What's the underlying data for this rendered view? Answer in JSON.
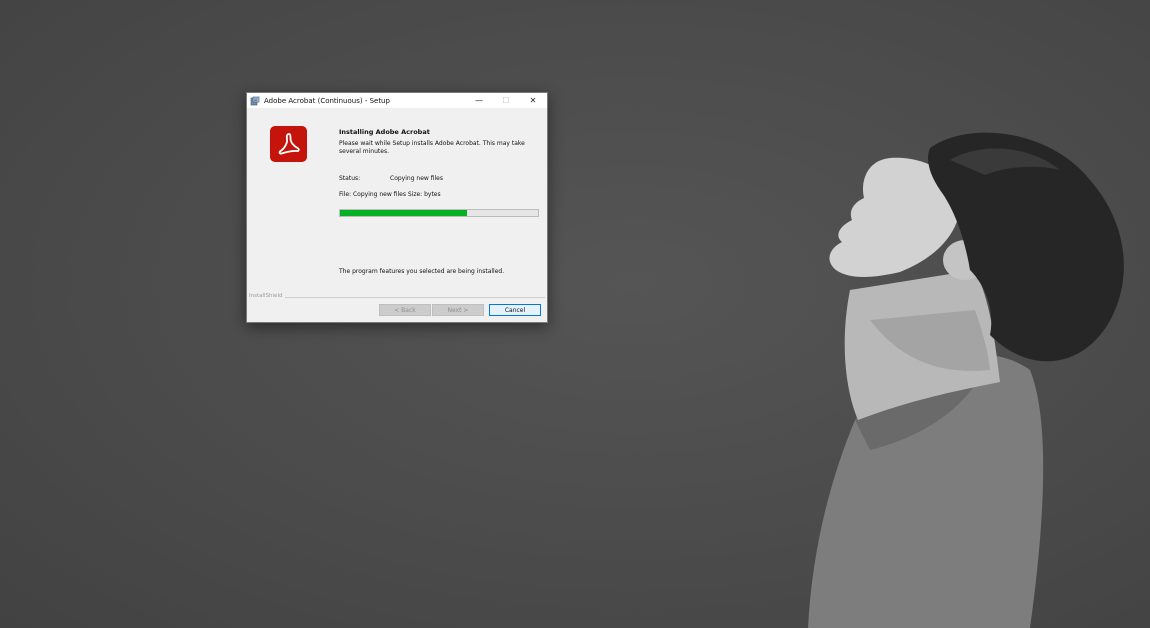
{
  "window": {
    "title": "Adobe Acrobat (Continuous) - Setup",
    "minimize_glyph": "—",
    "maximize_glyph": "☐",
    "close_glyph": "✕"
  },
  "installer": {
    "heading": "Installing Adobe Acrobat",
    "description": "Please wait while Setup installs Adobe Acrobat. This may take several minutes.",
    "status_label": "Status:",
    "status_value": "Copying new files",
    "file_line": "File: Copying new files Size:  bytes",
    "progress": 0.64,
    "progress_color": "#06b025",
    "footer_message": "The program features you selected are being installed.",
    "brand": "InstallShield"
  },
  "buttons": {
    "back_label": "< Back",
    "next_label": "Next >",
    "cancel_label": "Cancel"
  },
  "icons": {
    "title_icon": "setup-icon",
    "logo": "adobe-acrobat-icon"
  },
  "colors": {
    "acrobat_red": "#c4140c",
    "focus_blue": "#0078d7"
  }
}
